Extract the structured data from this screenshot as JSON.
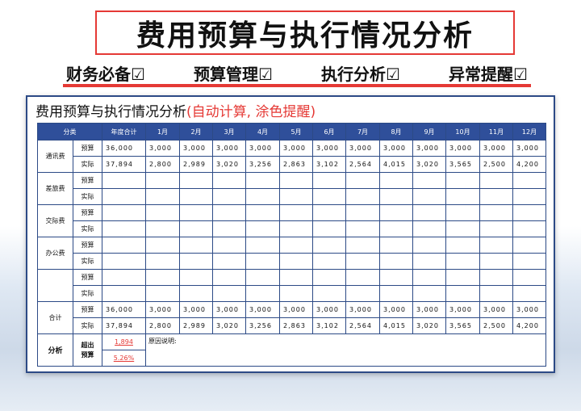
{
  "banner": {
    "title": "费用预算与执行情况分析",
    "tags": [
      "财务必备☑",
      "预算管理☑",
      "执行分析☑",
      "异常提醒☑"
    ]
  },
  "sheet": {
    "title_main": "费用预算与执行情况分析",
    "title_note": "(自动计算, 涂色提醒)"
  },
  "table": {
    "headers": [
      "分类",
      "年度合计",
      "1月",
      "2月",
      "3月",
      "4月",
      "5月",
      "6月",
      "7月",
      "8月",
      "9月",
      "10月",
      "11月",
      "12月"
    ],
    "budget_label": "预算",
    "actual_label": "实际",
    "categories": [
      {
        "name": "通讯费",
        "budget": [
          "36,000",
          "3,000",
          "3,000",
          "3,000",
          "3,000",
          "3,000",
          "3,000",
          "3,000",
          "3,000",
          "3,000",
          "3,000",
          "3,000",
          "3,000"
        ],
        "actual": [
          "37,894",
          "2,800",
          "2,989",
          "3,020",
          "3,256",
          "2,863",
          "3,102",
          "2,564",
          "4,015",
          "3,020",
          "3,565",
          "2,500",
          "4,200"
        ]
      },
      {
        "name": "差旅费",
        "budget": [
          "",
          "",
          "",
          "",
          "",
          "",
          "",
          "",
          "",
          "",
          "",
          "",
          ""
        ],
        "actual": [
          "",
          "",
          "",
          "",
          "",
          "",
          "",
          "",
          "",
          "",
          "",
          "",
          ""
        ]
      },
      {
        "name": "交际费",
        "budget": [
          "",
          "",
          "",
          "",
          "",
          "",
          "",
          "",
          "",
          "",
          "",
          "",
          ""
        ],
        "actual": [
          "",
          "",
          "",
          "",
          "",
          "",
          "",
          "",
          "",
          "",
          "",
          "",
          ""
        ]
      },
      {
        "name": "办公费",
        "budget": [
          "",
          "",
          "",
          "",
          "",
          "",
          "",
          "",
          "",
          "",
          "",
          "",
          ""
        ],
        "actual": [
          "",
          "",
          "",
          "",
          "",
          "",
          "",
          "",
          "",
          "",
          "",
          "",
          ""
        ]
      },
      {
        "name": "",
        "budget": [
          "",
          "",
          "",
          "",
          "",
          "",
          "",
          "",
          "",
          "",
          "",
          "",
          ""
        ],
        "actual": [
          "",
          "",
          "",
          "",
          "",
          "",
          "",
          "",
          "",
          "",
          "",
          "",
          ""
        ]
      },
      {
        "name": "合计",
        "budget": [
          "36,000",
          "3,000",
          "3,000",
          "3,000",
          "3,000",
          "3,000",
          "3,000",
          "3,000",
          "3,000",
          "3,000",
          "3,000",
          "3,000",
          "3,000"
        ],
        "actual": [
          "37,894",
          "2,800",
          "2,989",
          "3,020",
          "3,256",
          "2,863",
          "3,102",
          "2,564",
          "4,015",
          "3,020",
          "3,565",
          "2,500",
          "4,200"
        ]
      }
    ],
    "analysis": {
      "label": "分析",
      "over_label_1": "超出",
      "over_label_2": "预算",
      "over_amount": "1,894",
      "over_percent": "5.26%",
      "reason_label": "原因说明:"
    }
  }
}
